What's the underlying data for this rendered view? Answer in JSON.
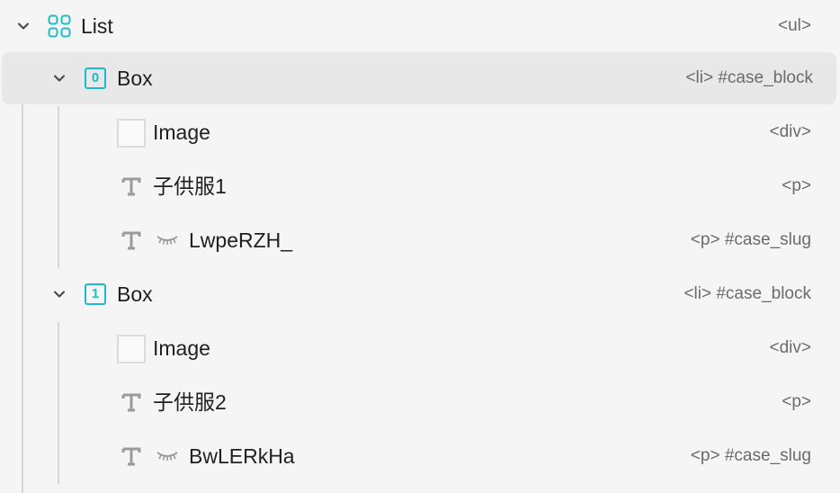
{
  "tree": {
    "list": {
      "label": "List",
      "tag": "<ul>",
      "icon": "grid-icon",
      "expanded": true
    },
    "items": [
      {
        "index": "0",
        "label": "Box",
        "tag": "<li> #case_block",
        "selected": true,
        "children": [
          {
            "type": "image",
            "label": "Image",
            "tag": "<div>"
          },
          {
            "type": "text",
            "label": "子供服1",
            "tag": "<p>"
          },
          {
            "type": "text",
            "hidden": true,
            "label": "LwpeRZH_",
            "tag": "<p> #case_slug"
          }
        ]
      },
      {
        "index": "1",
        "label": "Box",
        "tag": "<li> #case_block",
        "selected": false,
        "children": [
          {
            "type": "image",
            "label": "Image",
            "tag": "<div>"
          },
          {
            "type": "text",
            "label": "子供服2",
            "tag": "<p>"
          },
          {
            "type": "text",
            "hidden": true,
            "label": "BwLERkHa",
            "tag": "<p> #case_slug"
          }
        ]
      }
    ]
  },
  "colors": {
    "accent": "#1dbcc7",
    "selected_row": "#e8e8e8",
    "tag_text": "#6b6b6b",
    "guide_line": "#d6d6d6"
  }
}
